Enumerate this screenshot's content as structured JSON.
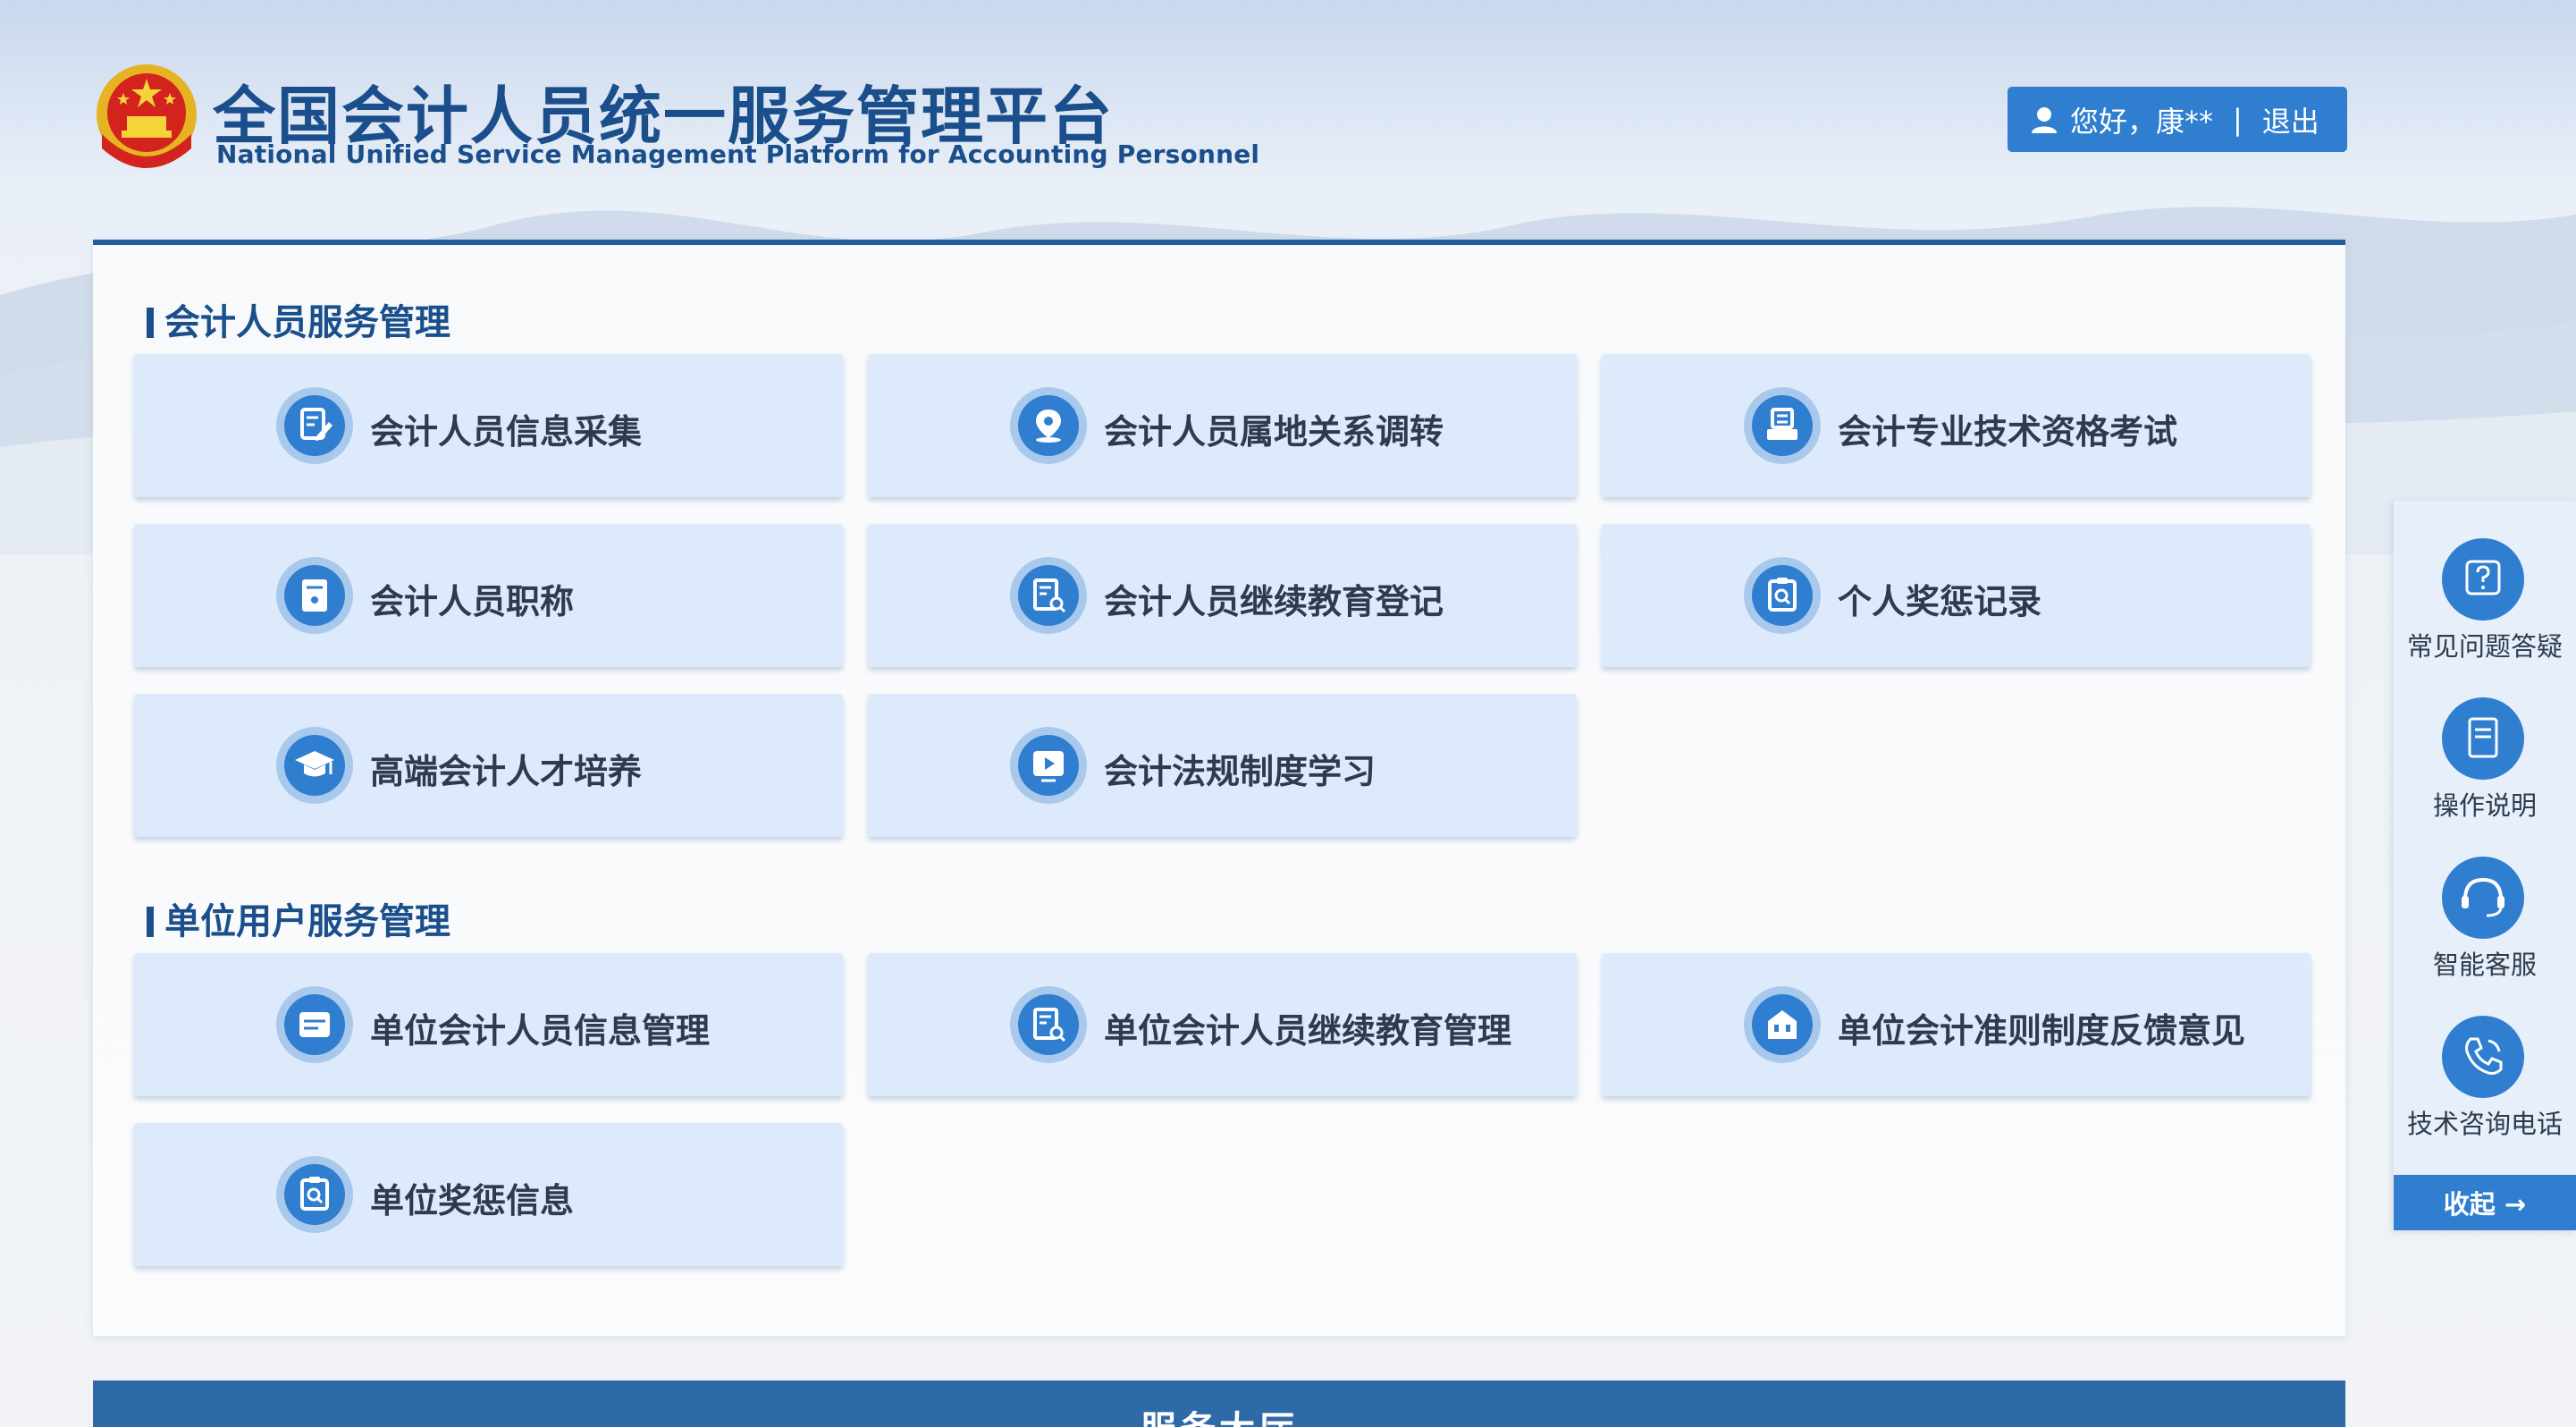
{
  "header": {
    "title_cn": "全国会计人员统一服务管理平台",
    "title_en": "National Unified Service Management Platform for Accounting Personnel",
    "greeting": "您好，康**",
    "separator": "|",
    "logout": "退出"
  },
  "sections": [
    {
      "title": "会计人员服务管理",
      "items": [
        {
          "label": "会计人员信息采集",
          "icon": "edit-document-icon"
        },
        {
          "label": "会计人员属地关系调转",
          "icon": "location-pin-icon"
        },
        {
          "label": "会计专业技术资格考试",
          "icon": "exam-printer-icon"
        },
        {
          "label": "会计人员职称",
          "icon": "certificate-icon"
        },
        {
          "label": "会计人员继续教育登记",
          "icon": "document-search-icon"
        },
        {
          "label": "个人奖惩记录",
          "icon": "clipboard-search-icon"
        },
        {
          "label": "高端会计人才培养",
          "icon": "graduation-cap-icon"
        },
        {
          "label": "会计法规制度学习",
          "icon": "video-play-icon"
        }
      ]
    },
    {
      "title": "单位用户服务管理",
      "items": [
        {
          "label": "单位会计人员信息管理",
          "icon": "card-list-icon"
        },
        {
          "label": "单位会计人员继续教育管理",
          "icon": "document-search-icon"
        },
        {
          "label": "单位会计准则制度反馈意见",
          "icon": "feedback-box-icon"
        },
        {
          "label": "单位奖惩信息",
          "icon": "clipboard-search-icon"
        }
      ]
    }
  ],
  "sidebar": {
    "items": [
      {
        "label": "常见问题答疑",
        "icon": "question-icon"
      },
      {
        "label": "操作说明",
        "icon": "manual-icon"
      },
      {
        "label": "智能客服",
        "icon": "headset-icon"
      },
      {
        "label": "技术咨询电话",
        "icon": "phone-icon"
      }
    ],
    "collapse": "收起 →"
  },
  "footer": {
    "title": "服务大厅"
  },
  "colors": {
    "primary": "#2f7ed0",
    "title": "#1a4f8c",
    "card": "#dceafb",
    "band": "#2e6aa8"
  }
}
